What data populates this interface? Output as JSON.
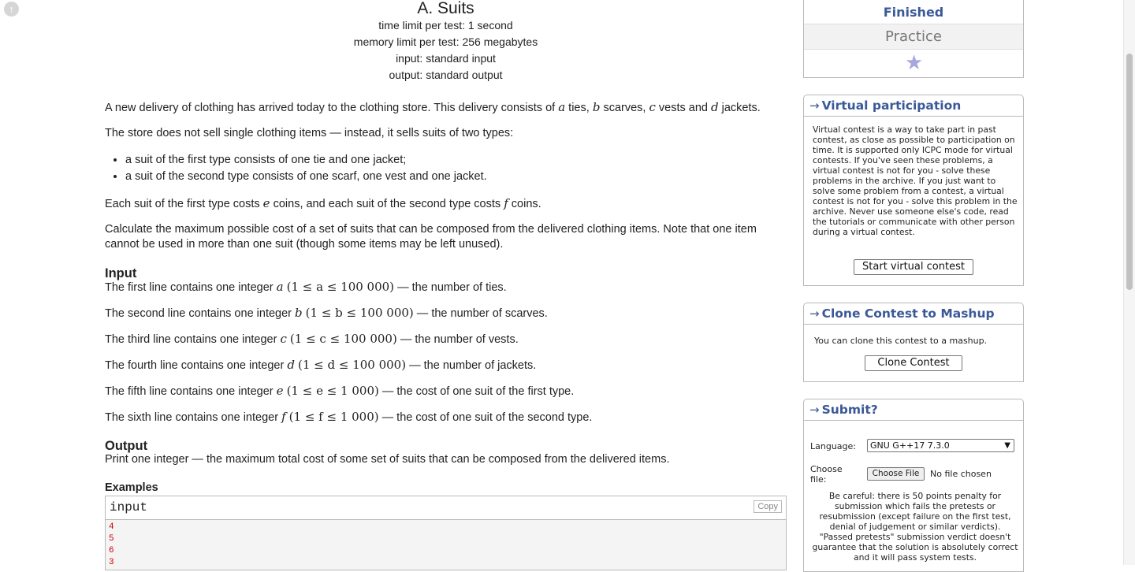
{
  "problem": {
    "title": "A. Suits",
    "time_limit": "time limit per test: 1 second",
    "memory_limit": "memory limit per test: 256 megabytes",
    "input_type": "input: standard input",
    "output_type": "output: standard output",
    "statement": {
      "p1_a": "A new delivery of clothing has arrived today to the clothing store. This delivery consists of ",
      "p1_v1": "a",
      "p1_b": " ties, ",
      "p1_v2": "b",
      "p1_c": " scarves, ",
      "p1_v3": "c",
      "p1_d": " vests and ",
      "p1_v4": "d",
      "p1_e": " jackets.",
      "p2": "The store does not sell single clothing items — instead, it sells suits of two types:",
      "bullets": [
        "a suit of the first type consists of one tie and one jacket;",
        "a suit of the second type consists of one scarf, one vest and one jacket."
      ],
      "p3_a": "Each suit of the first type costs ",
      "p3_v1": "e",
      "p3_b": " coins, and each suit of the second type costs ",
      "p3_v2": "f",
      "p3_c": " coins.",
      "p4": "Calculate the maximum possible cost of a set of suits that can be composed from the delivered clothing items. Note that one item cannot be used in more than one suit (though some items may be left unused)."
    },
    "input": {
      "title": "Input",
      "lines": [
        {
          "pre": "The first line contains one integer ",
          "var": "a",
          "range": "(1 ≤ a ≤ 100 000)",
          "post": " — the number of ties."
        },
        {
          "pre": "The second line contains one integer ",
          "var": "b",
          "range": "(1 ≤ b ≤ 100 000)",
          "post": " — the number of scarves."
        },
        {
          "pre": "The third line contains one integer ",
          "var": "c",
          "range": "(1 ≤ c ≤ 100 000)",
          "post": " — the number of vests."
        },
        {
          "pre": "The fourth line contains one integer ",
          "var": "d",
          "range": "(1 ≤ d ≤ 100 000)",
          "post": " — the number of jackets."
        },
        {
          "pre": "The fifth line contains one integer ",
          "var": "e",
          "range": "(1 ≤ e ≤ 1 000)",
          "post": " — the cost of one suit of the first type."
        },
        {
          "pre": "The sixth line contains one integer ",
          "var": "f",
          "range": "(1 ≤ f ≤ 1 000)",
          "post": " — the cost of one suit of the second type."
        }
      ]
    },
    "output": {
      "title": "Output",
      "text": "Print one integer — the maximum total cost of some set of suits that can be composed from the delivered items."
    },
    "examples": {
      "title": "Examples",
      "input_label": "input",
      "copy_label": "Copy",
      "input_lines": [
        "4",
        "5",
        "6",
        "3"
      ]
    }
  },
  "sidebar": {
    "status": {
      "finished": "Finished",
      "practice": "Practice"
    },
    "virtual": {
      "arrow": "→",
      "title": "Virtual participation",
      "text": "Virtual contest is a way to take part in past contest, as close as possible to participation on time. It is supported only ICPC mode for virtual contests. If you've seen these problems, a virtual contest is not for you - solve these problems in the archive. If you just want to solve some problem from a contest, a virtual contest is not for you - solve this problem in the archive. Never use someone else's code, read the tutorials or communicate with other person during a virtual contest.",
      "button": "Start virtual contest"
    },
    "clone": {
      "arrow": "→",
      "title": "Clone Contest to Mashup",
      "text": "You can clone this contest to a mashup.",
      "button": "Clone Contest"
    },
    "submit": {
      "arrow": "→",
      "title": "Submit?",
      "language_label": "Language:",
      "language_value": "GNU G++17 7.3.0",
      "file_label": "Choose file:",
      "file_button": "Choose File",
      "file_status": "No file chosen",
      "warning": "Be careful: there is 50 points penalty for submission which fails the pretests or resubmission (except failure on the first test, denial of judgement or similar verdicts). \"Passed pretests\" submission verdict doesn't guarantee that the solution is absolutely correct and it will pass system tests."
    }
  },
  "colors": {
    "link_blue": "#3b5998",
    "sample_red": "#cc0000",
    "border_gray": "#b9b9b9"
  },
  "icons": [
    "scroll-up-icon",
    "star-icon",
    "arrow-right-icon",
    "chevron-down-icon"
  ]
}
